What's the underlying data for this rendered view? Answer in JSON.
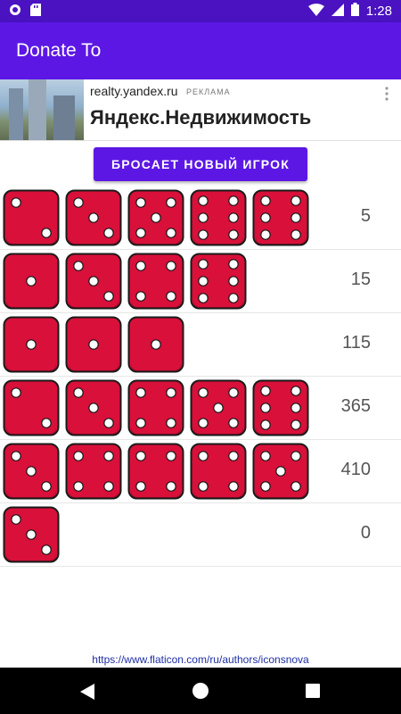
{
  "status": {
    "time": "1:28"
  },
  "appbar": {
    "title": "Donate To"
  },
  "ad": {
    "domain": "realty.yandex.ru",
    "label": "РЕКЛАМА",
    "headline": "Яндекс.Недвижимость"
  },
  "action": {
    "new_player_label": "БРОСАЕТ НОВЫЙ ИГРОК"
  },
  "colors": {
    "primary": "#5c17e5",
    "status": "#4a12c0",
    "die": "#d8103a"
  },
  "rows": [
    {
      "dice": [
        2,
        3,
        5,
        6,
        6
      ],
      "score": "5"
    },
    {
      "dice": [
        1,
        3,
        4,
        6
      ],
      "score": "15"
    },
    {
      "dice": [
        1,
        1,
        1
      ],
      "score": "115"
    },
    {
      "dice": [
        2,
        3,
        4,
        5,
        6
      ],
      "score": "365"
    },
    {
      "dice": [
        3,
        4,
        4,
        4,
        5
      ],
      "score": "410"
    },
    {
      "dice": [
        3
      ],
      "score": "0"
    }
  ],
  "footer": {
    "credit": "https://www.flaticon.com/ru/authors/iconsnova"
  }
}
